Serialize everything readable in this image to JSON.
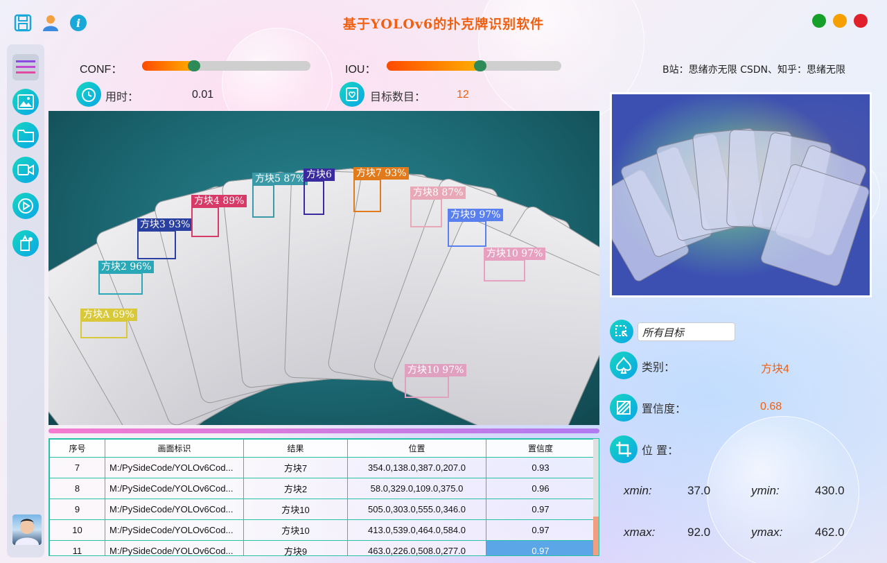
{
  "app": {
    "title": "基于YOLOv6的扑克牌识别软件"
  },
  "window": {
    "close_color": "#e0202a",
    "minimize_color": "#f5a000",
    "maximize_color": "#16a02a"
  },
  "controls": {
    "conf_label": "CONF：",
    "conf_value": 0.27,
    "iou_label": "IOU：",
    "iou_value": 0.5,
    "time_label": "用时：",
    "time_value": "0.01",
    "count_label": "目标数目：",
    "count_value": "12"
  },
  "credit": "B站：思绪亦无限  CSDN、知乎：思绪无限",
  "detections": [
    {
      "label": "方块A  69%",
      "color": "#d8c83a"
    },
    {
      "label": "方块2  96%",
      "color": "#2aa8b8"
    },
    {
      "label": "方块3  93%",
      "color": "#2a40a0"
    },
    {
      "label": "方块4  89%",
      "color": "#d83a68"
    },
    {
      "label": "方块5  87%",
      "color": "#3a9aa8"
    },
    {
      "label": "方块6",
      "color": "#3a2aa0"
    },
    {
      "label": "方块7  93%",
      "color": "#e07a1a"
    },
    {
      "label": "方块8  87%",
      "color": "#e8a8b8"
    },
    {
      "label": "方块9  97%",
      "color": "#5a80f0"
    },
    {
      "label": "方块10  97%",
      "color": "#e8a0c0"
    },
    {
      "label": "方块10  97%",
      "color": "#e0a0c0"
    }
  ],
  "table": {
    "headers": [
      "序号",
      "画面标识",
      "结果",
      "位置",
      "置信度"
    ],
    "rows": [
      [
        "7",
        "M:/PySideCode/YOLOv6Cod...",
        "方块7",
        "354.0,138.0,387.0,207.0",
        "0.93"
      ],
      [
        "8",
        "M:/PySideCode/YOLOv6Cod...",
        "方块2",
        "58.0,329.0,109.0,375.0",
        "0.96"
      ],
      [
        "9",
        "M:/PySideCode/YOLOv6Cod...",
        "方块10",
        "505.0,303.0,555.0,346.0",
        "0.97"
      ],
      [
        "10",
        "M:/PySideCode/YOLOv6Cod...",
        "方块10",
        "413.0,539.0,464.0,584.0",
        "0.97"
      ],
      [
        "11",
        "M:/PySideCode/YOLOv6Cod...",
        "方块9",
        "463.0,226.0,508.0,277.0",
        "0.97"
      ]
    ],
    "selected_row": 4
  },
  "target_select": {
    "value": "所有目标"
  },
  "result": {
    "class_label": "类别：",
    "class_value": "方块4",
    "conf_label": "置信度：",
    "conf_value": "0.68",
    "pos_label": "位 置：",
    "xmin_label": "xmin:",
    "xmin": "37.0",
    "ymin_label": "ymin:",
    "ymin": "430.0",
    "xmax_label": "xmax:",
    "xmax": "92.0",
    "ymax_label": "ymax:",
    "ymax": "462.0"
  }
}
